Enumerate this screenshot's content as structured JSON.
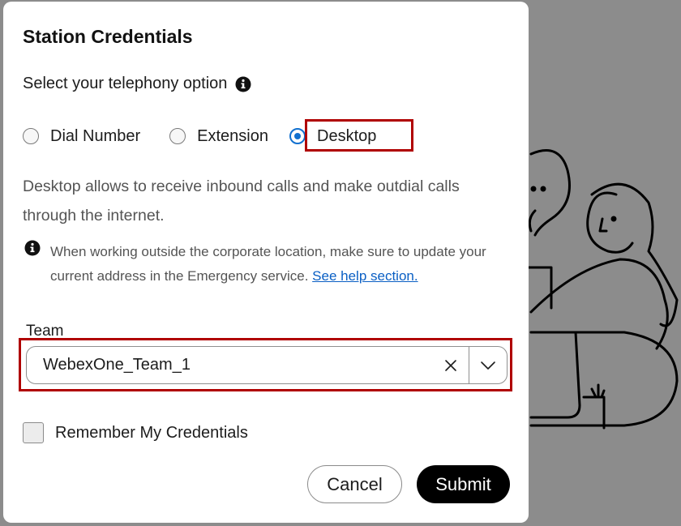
{
  "dialog": {
    "title": "Station Credentials",
    "subtitle": "Select your telephony option",
    "telephony_options": [
      {
        "label": "Dial Number",
        "selected": false
      },
      {
        "label": "Extension",
        "selected": false
      },
      {
        "label": "Desktop",
        "selected": true
      }
    ],
    "description": "Desktop allows to receive inbound calls and make outdial calls through the internet.",
    "note": {
      "text": "When working outside the corporate location, make sure to update your current address in the Emergency service.",
      "link": "See help section."
    },
    "team": {
      "label": "Team",
      "value": "WebexOne_Team_1"
    },
    "remember_label": "Remember My Credentials",
    "remember_checked": false,
    "buttons": {
      "cancel": "Cancel",
      "submit": "Submit"
    }
  },
  "colors": {
    "accent": "#1170cf",
    "highlight": "#b00000",
    "overlay": "#8c8c8c",
    "link": "#0a5fc4"
  },
  "icons": {
    "info": "info-icon",
    "clear": "close-icon",
    "dropdown": "chevron-down-icon"
  }
}
